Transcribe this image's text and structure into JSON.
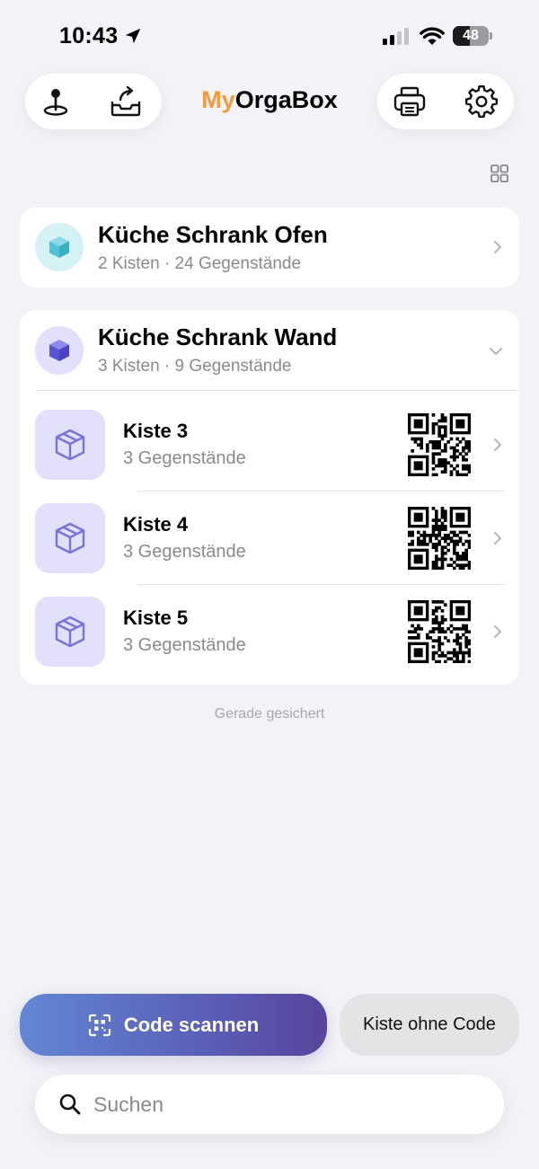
{
  "status_bar": {
    "time": "10:43",
    "battery_level": "48"
  },
  "header": {
    "title_prefix": "My",
    "title_suffix": "OrgaBox",
    "brand_color": "#f39a3c",
    "left_icons": [
      "location-pin-icon",
      "export-tray-icon"
    ],
    "right_icons": [
      "printer-icon",
      "gear-icon"
    ],
    "view_toggle_icon": "grid-view-icon"
  },
  "locations": [
    {
      "name": "Küche Schrank Ofen",
      "summary": "2 Kisten · 24 Gegenstände",
      "icon": "cube-icon",
      "icon_color": "#4fc3d7",
      "expanded": false
    },
    {
      "name": "Küche Schrank Wand",
      "summary": "3 Kisten · 9 Gegenstände",
      "icon": "cube-icon",
      "icon_color": "#5b54d6",
      "expanded": true,
      "boxes": [
        {
          "name": "Kiste 3",
          "count": "3 Gegenstände"
        },
        {
          "name": "Kiste 4",
          "count": "3 Gegenstände"
        },
        {
          "name": "Kiste 5",
          "count": "3 Gegenstände"
        }
      ]
    }
  ],
  "sync_status": "Gerade gesichert",
  "actions": {
    "scan_label": "Code scannen",
    "no_code_label": "Kiste ohne Code"
  },
  "search": {
    "placeholder": "Suchen"
  }
}
